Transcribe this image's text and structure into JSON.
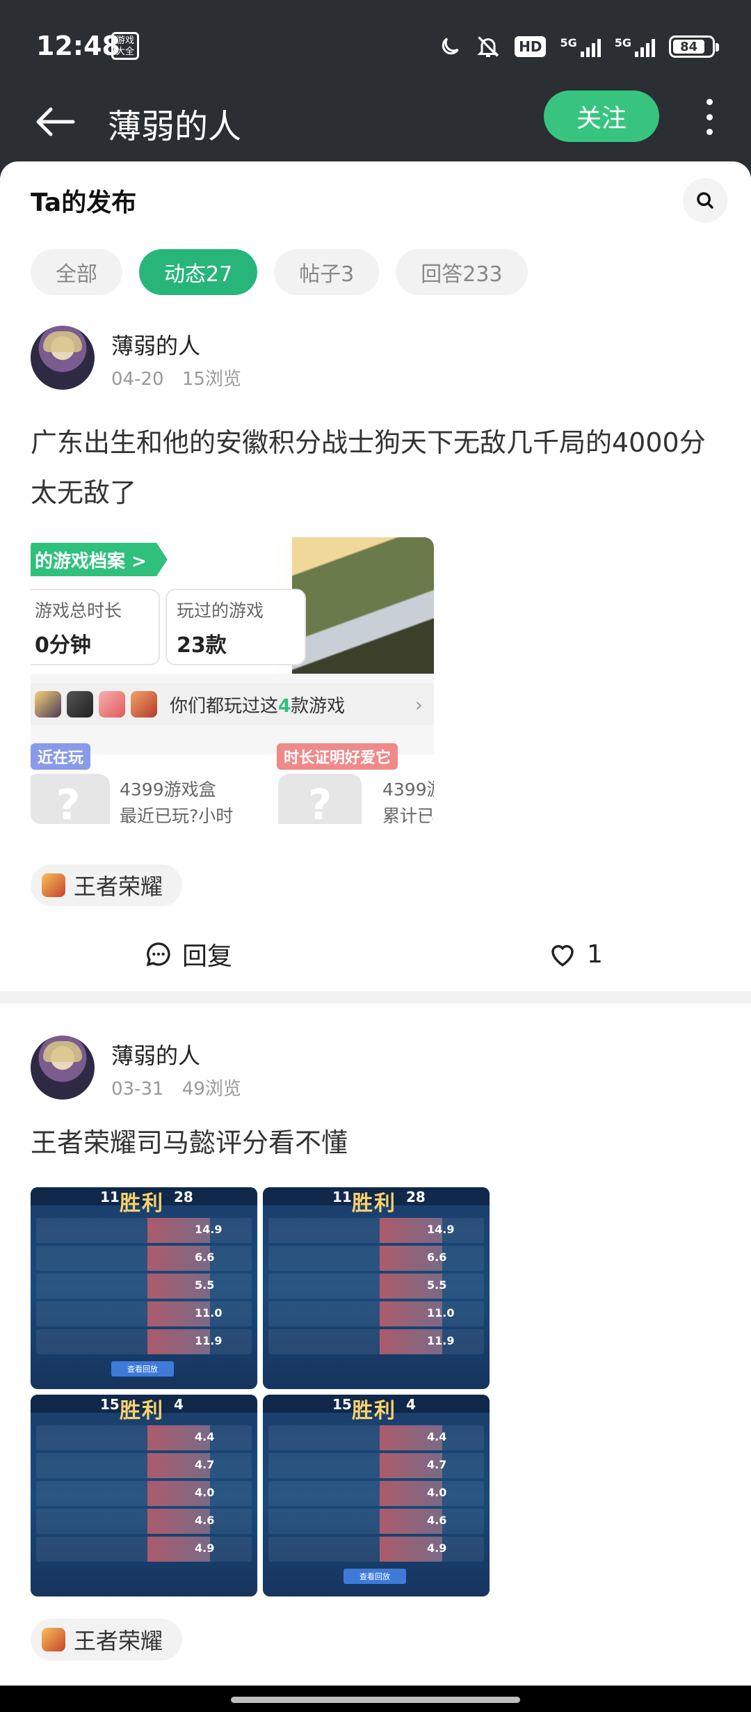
{
  "status_bar": {
    "time": "12:48",
    "game_box_label": "游戏大全",
    "hd_label": "HD",
    "network_1": "5G",
    "network_2": "5G",
    "battery": "84"
  },
  "header": {
    "title": "薄弱的人",
    "follow_label": "关注"
  },
  "section": {
    "title": "Ta的发布"
  },
  "tabs": [
    {
      "label": "全部",
      "active": false
    },
    {
      "label": "动态27",
      "active": true
    },
    {
      "label": "帖子3",
      "active": false
    },
    {
      "label": "回答233",
      "active": false
    }
  ],
  "posts": [
    {
      "author": "薄弱的人",
      "date": "04-20",
      "views": "15浏览",
      "text": "广东出生和他的安徽积分战士狗天下无敌几千局的4000分太无敌了",
      "image": {
        "header": "的游戏档案 >",
        "box1_label": "游戏总时长",
        "box1_value": "0分钟",
        "box2_label": "玩过的游戏",
        "box2_value": "23款",
        "common_prefix": "你们都玩过这",
        "common_count": "4",
        "common_suffix": "款游戏",
        "chevron": "›",
        "recent_label": "近在玩",
        "proof_label": "时长证明好爱它",
        "recent_line1": "4399游戏盒",
        "recent_line2": "最近已玩?小时",
        "proof_line1": "4399游",
        "proof_line2": "累计已"
      },
      "tag": "王者荣耀",
      "reply_label": "回复",
      "like_count": "1"
    },
    {
      "author": "薄弱的人",
      "date": "03-31",
      "views": "49浏览",
      "text": "王者荣耀司马懿评分看不懂",
      "images": [
        {
          "left": "11",
          "result": "胜利",
          "right": "28",
          "scores": [
            "14.9",
            "6.6",
            "5.5",
            "11.0",
            "11.9"
          ],
          "button": "查看回放"
        },
        {
          "left": "11",
          "result": "胜利",
          "right": "28",
          "scores": [
            "14.9",
            "6.6",
            "5.5",
            "11.0",
            "11.9"
          ],
          "button": ""
        },
        {
          "left": "15",
          "result": "胜利",
          "right": "4",
          "scores": [
            "4.4",
            "4.7",
            "4.0",
            "4.6",
            "4.9"
          ],
          "button": ""
        },
        {
          "left": "15",
          "result": "胜利",
          "right": "4",
          "scores": [
            "4.4",
            "4.7",
            "4.0",
            "4.6",
            "4.9"
          ],
          "button": "查看回放"
        }
      ],
      "tag": "王者荣耀"
    }
  ]
}
